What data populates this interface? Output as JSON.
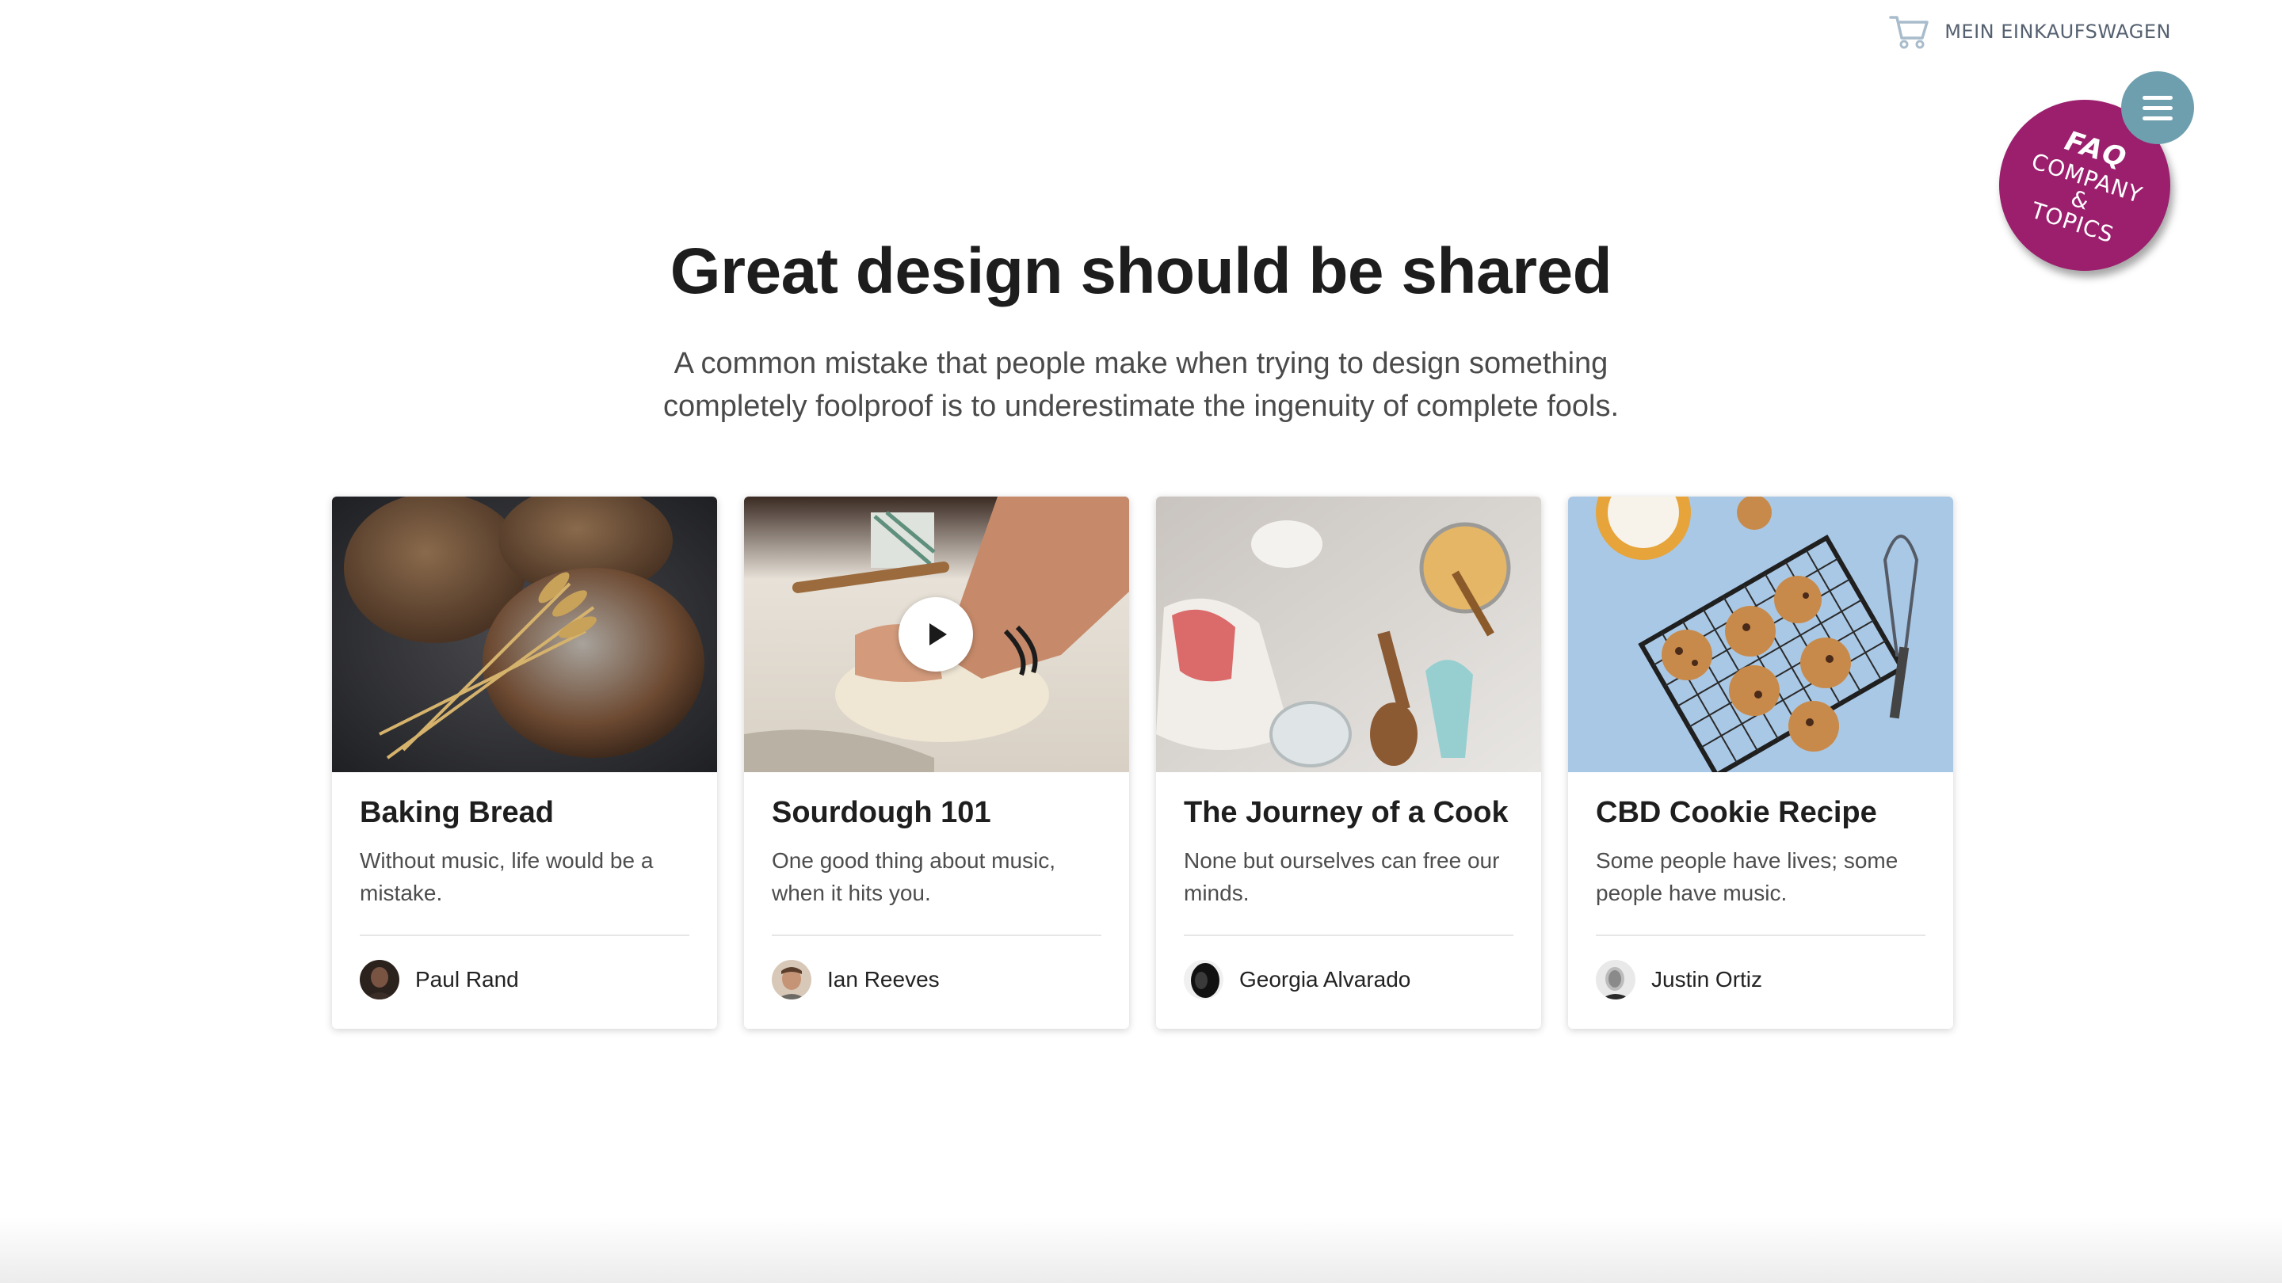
{
  "header": {
    "cart_label": "MEIN EINKAUFSWAGEN",
    "cart_icon": "shopping-cart-icon",
    "menu_icon": "hamburger-menu-icon"
  },
  "faq_badge": {
    "line1": "FAQ",
    "line2": "COMPANY",
    "line3": "&",
    "line4": "TOPICS",
    "color": "#9b1f6d"
  },
  "hero": {
    "title": "Great design should be shared",
    "subtitle": "A common mistake that people make when trying to design something completely foolproof is to underestimate the ingenuity of complete fools."
  },
  "cards": [
    {
      "image": "bread-loaves-photo",
      "title": "Baking Bread",
      "text": "Without music, life would be a mistake.",
      "author": "Paul Rand"
    },
    {
      "image": "kneading-dough-video-thumbnail",
      "has_play": true,
      "title": "Sourdough 101",
      "text": "One good thing about music, when it hits you.",
      "author": "Ian Reeves"
    },
    {
      "image": "baking-ingredients-photo",
      "title": "The Journey of a Cook",
      "text": "None but ourselves can free our minds.",
      "author": "Georgia Alvarado"
    },
    {
      "image": "cookies-on-rack-photo",
      "title": "CBD Cookie Recipe",
      "text": "Some people have lives; some people have music.",
      "author": "Justin Ortiz"
    }
  ],
  "colors": {
    "accent_badge": "#9b1f6d",
    "menu_button": "#6e9fae",
    "text_dark": "#1d1d1d"
  }
}
